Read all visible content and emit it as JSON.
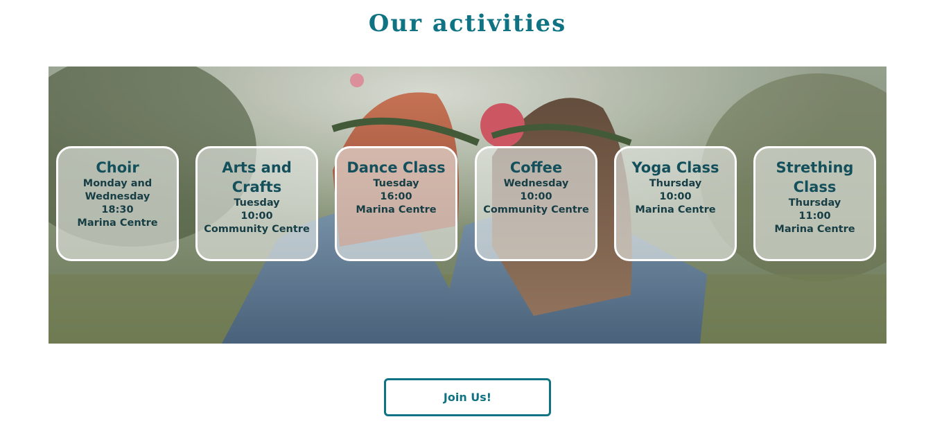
{
  "section": {
    "title": "Our activities"
  },
  "banner": {
    "image": "two-women-flower-crowns-photo"
  },
  "activities": [
    {
      "title": "Choir",
      "lines": [
        "Monday and Wednesday",
        "18:30",
        "Marina Centre"
      ]
    },
    {
      "title": "Arts and Crafts",
      "lines": [
        "Tuesday",
        "10:00",
        "Community Centre"
      ]
    },
    {
      "title": "Dance Class",
      "lines": [
        "Tuesday",
        "16:00",
        "Marina Centre"
      ]
    },
    {
      "title": "Coffee",
      "lines": [
        "Wednesday",
        "10:00",
        "Community Centre"
      ]
    },
    {
      "title": "Yoga Class",
      "lines": [
        "Thursday",
        "10:00",
        "Marina Centre"
      ]
    },
    {
      "title": "Strething Class",
      "lines": [
        "Thursday",
        "11:00",
        "Marina Centre"
      ]
    }
  ],
  "cta": {
    "label": "Join Us!"
  },
  "colors": {
    "accent": "#0f7384",
    "card_text": "#14505c",
    "card_border": "#ffffff"
  }
}
